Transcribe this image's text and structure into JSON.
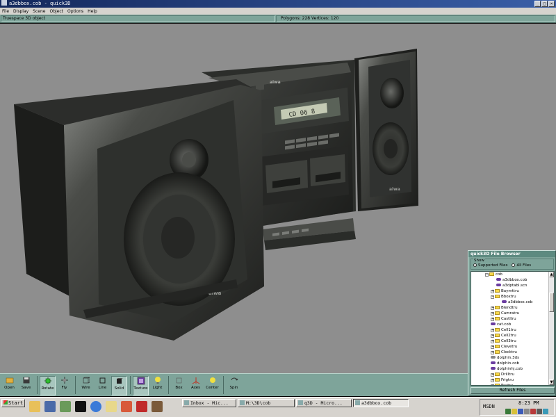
{
  "window": {
    "title": "a3dbbox.cob - quick3D",
    "controls": [
      "_",
      "□",
      "×"
    ]
  },
  "menu": [
    "File",
    "Display",
    "Scene",
    "Object",
    "Options",
    "Help"
  ],
  "infobar": {
    "object_type": "Truespace 3D object",
    "stats": "Polygons: 228  Vertices: 120"
  },
  "scene": {
    "lcd_text": "CD 06 8",
    "brand_left": "aiwa",
    "brand_right": "aiwa",
    "brand_top": "aiwa"
  },
  "toolbar": [
    {
      "name": "open",
      "label": "Open",
      "icon": "folder-open-icon",
      "active": false
    },
    {
      "name": "save",
      "label": "Save",
      "icon": "floppy-icon",
      "active": false
    },
    {
      "sep": true
    },
    {
      "name": "rotate",
      "label": "Rotate",
      "icon": "rotate-icon",
      "active": true
    },
    {
      "name": "fly",
      "label": "Fly",
      "icon": "fly-icon",
      "active": false
    },
    {
      "sep": true
    },
    {
      "name": "wire",
      "label": "Wire",
      "icon": "wire-icon",
      "active": false
    },
    {
      "name": "line",
      "label": "Line",
      "icon": "line-icon",
      "active": false
    },
    {
      "name": "solid",
      "label": "Solid",
      "icon": "solid-icon",
      "active": true
    },
    {
      "sep": true
    },
    {
      "name": "texture",
      "label": "Texture",
      "icon": "texture-icon",
      "active": true
    },
    {
      "name": "light",
      "label": "Light",
      "icon": "bulb-icon",
      "active": false
    },
    {
      "sep": true
    },
    {
      "name": "box",
      "label": "Box",
      "icon": "box-icon",
      "active": false
    },
    {
      "name": "axes",
      "label": "Axes",
      "icon": "axes-icon",
      "active": false
    },
    {
      "name": "center",
      "label": "Center",
      "icon": "center-icon",
      "active": false
    },
    {
      "sep": true
    },
    {
      "name": "spin",
      "label": "Spin",
      "icon": "spin-icon",
      "active": false
    }
  ],
  "browser": {
    "title": "quick3D File Browser",
    "show_label": "Show",
    "option_supported": "Supported Files",
    "option_all": "All Files",
    "refresh_label": "Refresh Files",
    "tree": [
      {
        "label": "cob",
        "type": "folder",
        "depth": 0,
        "exp": "−"
      },
      {
        "label": "a3dbbox.cob",
        "type": "file",
        "depth": 2
      },
      {
        "label": "a3dptabl.scn",
        "type": "file",
        "depth": 2
      },
      {
        "label": "Baymttru",
        "type": "folder",
        "depth": 1,
        "exp": "+"
      },
      {
        "label": "Bboxtru",
        "type": "folder",
        "depth": 1,
        "exp": "−"
      },
      {
        "label": "a3dbbox.cob",
        "type": "file",
        "depth": 3
      },
      {
        "label": "Blendtru",
        "type": "folder",
        "depth": 1,
        "exp": "+"
      },
      {
        "label": "Camratru",
        "type": "folder",
        "depth": 1,
        "exp": "+"
      },
      {
        "label": "Castltru",
        "type": "folder",
        "depth": 1,
        "exp": "+"
      },
      {
        "label": "cat.cob",
        "type": "file",
        "depth": 1
      },
      {
        "label": "Cell1tru",
        "type": "folder",
        "depth": 1,
        "exp": "+"
      },
      {
        "label": "Cell2tru",
        "type": "folder",
        "depth": 1,
        "exp": "+"
      },
      {
        "label": "Cell3tru",
        "type": "folder",
        "depth": 1,
        "exp": "+"
      },
      {
        "label": "Clevetru",
        "type": "folder",
        "depth": 1,
        "exp": "+"
      },
      {
        "label": "Clocktru",
        "type": "folder",
        "depth": 1,
        "exp": "+"
      },
      {
        "label": "dolphin.3ds",
        "type": "file3ds",
        "depth": 1
      },
      {
        "label": "dolphin.cob",
        "type": "file",
        "depth": 1
      },
      {
        "label": "dolphinhj.cob",
        "type": "file",
        "depth": 1
      },
      {
        "label": "Drilltru",
        "type": "folder",
        "depth": 1,
        "exp": "+"
      },
      {
        "label": "Frigtru",
        "type": "folder",
        "depth": 1,
        "exp": "+"
      },
      {
        "label": "Fsxtru",
        "type": "folder",
        "depth": 1,
        "exp": "+"
      }
    ]
  },
  "taskbar": {
    "start": "Start",
    "tasks": [
      {
        "label": "Inbox - Mic...",
        "active": false
      },
      {
        "label": "M:\\3D\\cob",
        "active": false
      },
      {
        "label": "q3D - Micro...",
        "active": false
      },
      {
        "label": "a3dbbox.cob",
        "active": true
      }
    ],
    "tray_label": "MSDN",
    "clock": "8:23 PM"
  },
  "colors": {
    "panel": "#7ea49a",
    "viewport": "#8e8e8e",
    "titlebar": "#14285c"
  }
}
